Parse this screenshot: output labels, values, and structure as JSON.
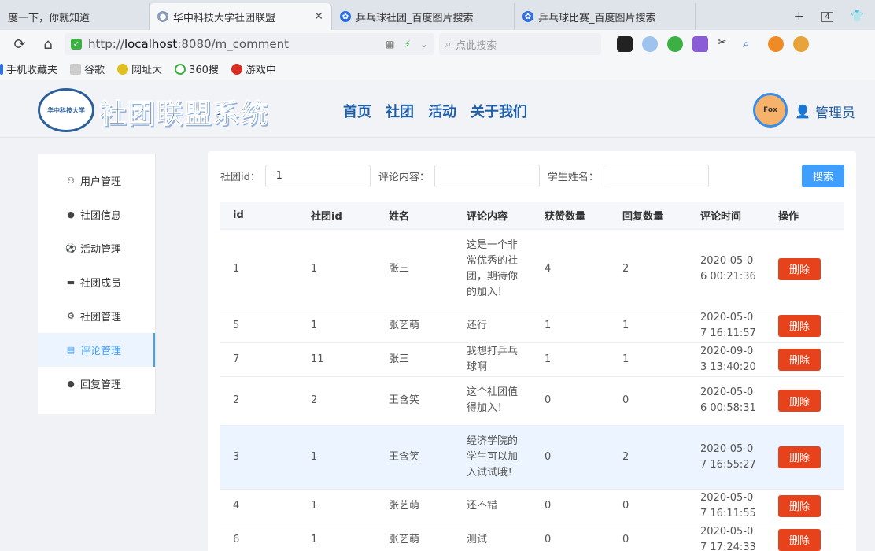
{
  "browser": {
    "tabs": [
      {
        "label": "度一下，你就知道",
        "active": false
      },
      {
        "label": "华中科技大学社团联盟",
        "active": true
      },
      {
        "label": "乒乓球社团_百度图片搜索",
        "active": false
      },
      {
        "label": "乒乓球比赛_百度图片搜索",
        "active": false
      }
    ],
    "tab_count": "4",
    "url_prefix": "http://",
    "url_host": "localhost",
    "url_rest": ":8080/m_comment",
    "search_placeholder": "点此搜索",
    "bookmarks": [
      "手机收藏夹",
      "谷歌",
      "网址大",
      "360搜",
      "游戏中"
    ]
  },
  "site": {
    "title": "社团联盟系统",
    "emblem_text": "华中科技大学",
    "nav": [
      "首页",
      "社团",
      "活动",
      "关于我们"
    ],
    "avatar_text": "Fox",
    "user_label": "管理员"
  },
  "sidebar": {
    "items": [
      {
        "label": "用户管理",
        "icon": "users-icon"
      },
      {
        "label": "社团信息",
        "icon": "chat-icon"
      },
      {
        "label": "活动管理",
        "icon": "soccer-icon"
      },
      {
        "label": "社团成员",
        "icon": "folder-icon"
      },
      {
        "label": "社团管理",
        "icon": "gear-icon"
      },
      {
        "label": "评论管理",
        "icon": "comment-icon",
        "active": true
      },
      {
        "label": "回复管理",
        "icon": "reply-icon"
      }
    ]
  },
  "filters": {
    "club_id_label": "社团id：",
    "club_id_value": "-1",
    "content_label": "评论内容：",
    "content_value": "",
    "student_label": "学生姓名：",
    "student_value": "",
    "search_button": "搜索"
  },
  "table": {
    "headers": [
      "id",
      "社团id",
      "姓名",
      "评论内容",
      "获赞数量",
      "回复数量",
      "评论时间",
      "操作"
    ],
    "delete_label": "删除",
    "rows": [
      {
        "id": "1",
        "club_id": "1",
        "name": "张三",
        "content": "这是一个非常优秀的社团，期待你的加入！",
        "likes": "4",
        "replies": "2",
        "time": "2020-05-06 00:21:36"
      },
      {
        "id": "5",
        "club_id": "1",
        "name": "张艺萌",
        "content": "还行",
        "likes": "1",
        "replies": "1",
        "time": "2020-05-07 16:11:57"
      },
      {
        "id": "7",
        "club_id": "11",
        "name": "张三",
        "content": "我想打乒乓球啊",
        "likes": "1",
        "replies": "1",
        "time": "2020-09-03 13:40:20"
      },
      {
        "id": "2",
        "club_id": "2",
        "name": "王含笑",
        "content": "这个社团值得加入！",
        "likes": "0",
        "replies": "0",
        "time": "2020-05-06 00:58:31"
      },
      {
        "id": "3",
        "club_id": "1",
        "name": "王含笑",
        "content": "经济学院的学生可以加入试试哦！",
        "likes": "0",
        "replies": "2",
        "time": "2020-05-07 16:55:27",
        "highlight": true
      },
      {
        "id": "4",
        "club_id": "1",
        "name": "张艺萌",
        "content": "还不错",
        "likes": "0",
        "replies": "0",
        "time": "2020-05-07 16:11:55"
      },
      {
        "id": "6",
        "club_id": "1",
        "name": "张艺萌",
        "content": "测试",
        "likes": "0",
        "replies": "0",
        "time": "2020-05-07 17:24:33"
      }
    ]
  }
}
